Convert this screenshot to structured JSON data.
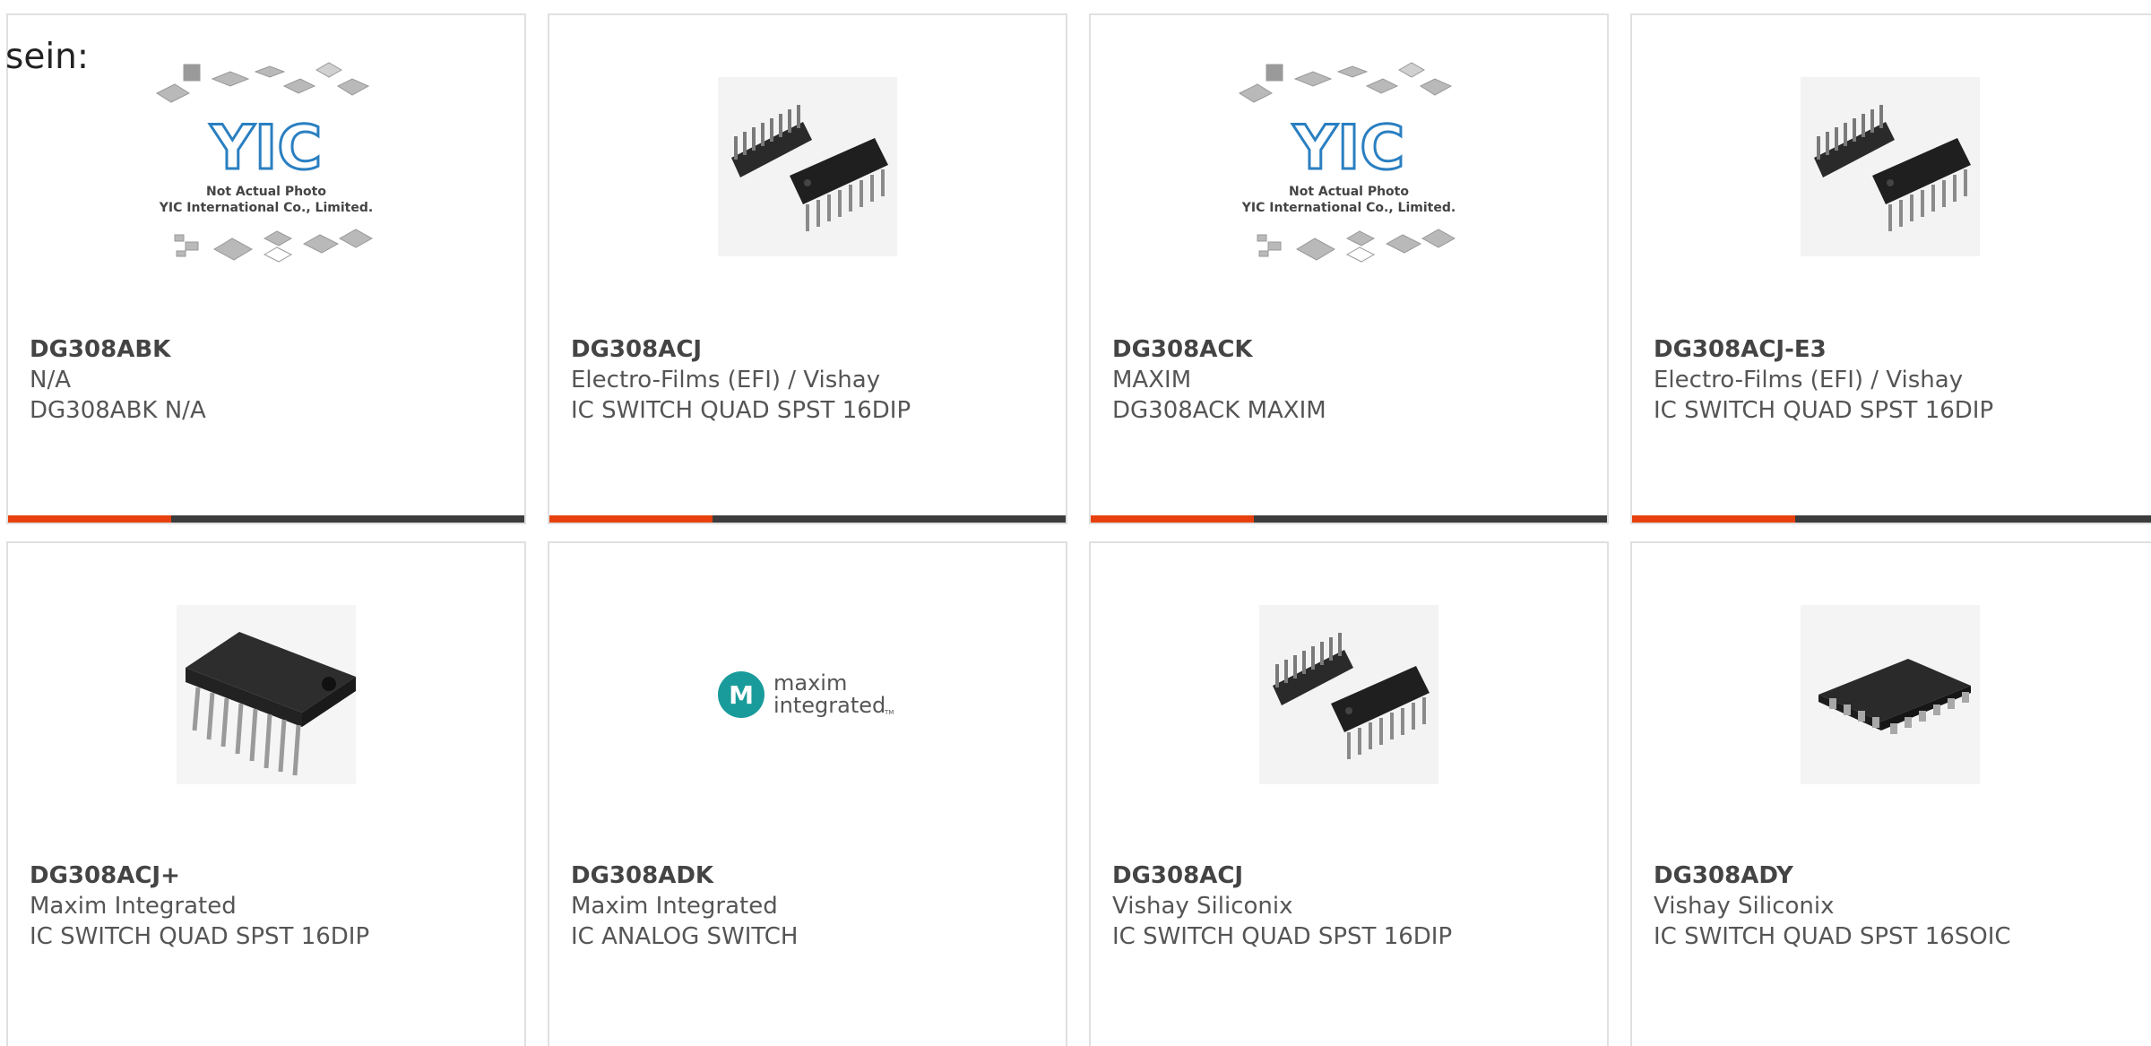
{
  "intro_text": "sein:",
  "colors": {
    "accent": "#e8400c",
    "bar": "#3c3c3c",
    "border": "#e0e0e0",
    "text": "#555555"
  },
  "cards": [
    {
      "part": "DG308ABK",
      "manufacturer": "N/A",
      "description": "DG308ABK N/A",
      "image": "yic-placeholder-icon",
      "image_text": [
        "Not Actual Photo",
        "YIC International Co., Limited."
      ],
      "image_logo": "YIC"
    },
    {
      "part": "DG308ACJ",
      "manufacturer": "Electro-Films (EFI) / Vishay",
      "description": "IC SWITCH QUAD SPST 16DIP",
      "image": "dip-chips-pair-icon"
    },
    {
      "part": "DG308ACK",
      "manufacturer": "MAXIM",
      "description": "DG308ACK MAXIM",
      "image": "yic-placeholder-icon",
      "image_text": [
        "Not Actual Photo",
        "YIC International Co., Limited."
      ],
      "image_logo": "YIC"
    },
    {
      "part": "DG308ACJ-E3",
      "manufacturer": "Electro-Films (EFI) / Vishay",
      "description": "IC SWITCH QUAD SPST 16DIP",
      "image": "dip-chips-pair-icon"
    },
    {
      "part": "DG308ACJ+",
      "manufacturer": "Maxim Integrated",
      "description": "IC SWITCH QUAD SPST 16DIP",
      "image": "dip-chip-single-icon"
    },
    {
      "part": "DG308ADK",
      "manufacturer": "Maxim Integrated",
      "description": "IC ANALOG SWITCH",
      "image": "maxim-logo-icon",
      "image_logo_lines": [
        "maxim",
        "integrated"
      ],
      "image_logo_tm": "TM"
    },
    {
      "part": "DG308ACJ",
      "manufacturer": "Vishay Siliconix",
      "description": "IC SWITCH QUAD SPST 16DIP",
      "image": "dip-chips-pair-icon"
    },
    {
      "part": "DG308ADY",
      "manufacturer": "Vishay Siliconix",
      "description": "IC SWITCH QUAD SPST 16SOIC",
      "image": "soic-chip-icon"
    }
  ]
}
